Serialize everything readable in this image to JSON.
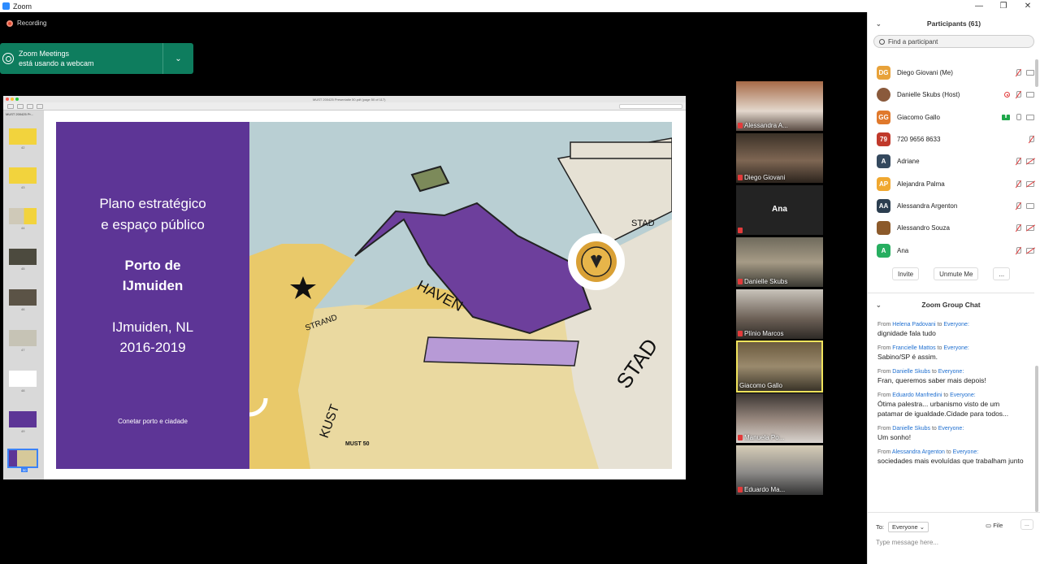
{
  "window": {
    "title": "Zoom",
    "controls": [
      "—",
      "❐",
      "✕"
    ]
  },
  "recording": {
    "label": "Recording"
  },
  "toast": {
    "line1": "Zoom Meetings",
    "line2": "está usando a webcam",
    "chevron": "⌄"
  },
  "share": {
    "doc_title": "MUST 200425 Presentatie 50.pdf (page 50 of 117)",
    "thumbs_file": "MUST 200425 Pr...",
    "thumb_numbers": [
      "42",
      "43",
      "44",
      "45",
      "46",
      "47",
      "48",
      "49",
      "50"
    ],
    "slide": {
      "subtitle_line1": "Plano estratégico",
      "subtitle_line2": "e espaço público",
      "title_line1": "Porto de",
      "title_line2": "IJmuiden",
      "place_line1": "IJmuiden, NL",
      "place_line2": "2016-2019",
      "tagline": "Conetar porto e ciadade",
      "map_labels": {
        "haven": "HAVEN",
        "stad_top": "STAD",
        "stad_big": "STAD",
        "strand": "STRAND",
        "kust": "KUST",
        "must": "MUST 50"
      },
      "colors": {
        "purple": "#5d3596",
        "sea": "#b9cfd3",
        "sand": "#e9c96a",
        "gear": "#d9a035"
      }
    }
  },
  "gallery": [
    {
      "name": "Alessandra A...",
      "muted": true
    },
    {
      "name": "Diego Giovani",
      "muted": true
    },
    {
      "name": "Ana",
      "muted": true,
      "no_video": true
    },
    {
      "name": "Danielle Skubs",
      "muted": true
    },
    {
      "name": "Plínio Marcos",
      "muted": true
    },
    {
      "name": "Giacomo Gallo",
      "muted": false,
      "active": true
    },
    {
      "name": "Manuela Po...",
      "muted": true
    },
    {
      "name": "Eduardo Ma...",
      "muted": true
    }
  ],
  "participants": {
    "header": "Participants (61)",
    "search_placeholder": "Find a participant",
    "list": [
      {
        "initials": "DG",
        "name": "Diego Giovani (Me)",
        "color": "#e8a23a"
      },
      {
        "initials": "",
        "name": "Danielle Skubs (Host)",
        "color": "#8a5a3c"
      },
      {
        "initials": "GG",
        "name": "Giacomo Gallo",
        "color": "#e0792c"
      },
      {
        "initials": "79",
        "name": "720 9656 8633",
        "color": "#c0392b"
      },
      {
        "initials": "A",
        "name": "Adriane",
        "color": "#34495e"
      },
      {
        "initials": "AP",
        "name": "Alejandra Palma",
        "color": "#f0a830"
      },
      {
        "initials": "AA",
        "name": "Alessandra Argenton",
        "color": "#2c3e50"
      },
      {
        "initials": "",
        "name": "Alessandro Souza",
        "color": "#8c5a2b"
      },
      {
        "initials": "A",
        "name": "Ana",
        "color": "#27ae60"
      }
    ],
    "invite": "Invite",
    "unmute_me": "Unmute Me",
    "more": "..."
  },
  "chat": {
    "header": "Zoom Group Chat",
    "from_word": "From",
    "to_word": "to",
    "messages": [
      {
        "from": "Helena Padovani",
        "to": "Everyone:",
        "text": "dignidade fala tudo"
      },
      {
        "from": "Francielle Mattos",
        "to": "Everyone:",
        "text": "Sabino/SP é assim."
      },
      {
        "from": "Danielle Skubs",
        "to": "Everyone:",
        "text": "Fran, queremos saber mais depois!"
      },
      {
        "from": "Eduardo Manfredini",
        "to": "Everyone:",
        "text": "Ótima palestra... urbanismo visto de um patamar de igualdade.Cidade para todos..."
      },
      {
        "from": "Danielle Skubs",
        "to": "Everyone:",
        "text": "Um sonho!"
      },
      {
        "from": "Alessandra Argenton",
        "to": "Everyone:",
        "text": "sociedades mais evoluídas que trabalham junto"
      }
    ],
    "to_label": "To:",
    "to_value": "Everyone",
    "file": "File",
    "more": "...",
    "placeholder": "Type message here..."
  }
}
